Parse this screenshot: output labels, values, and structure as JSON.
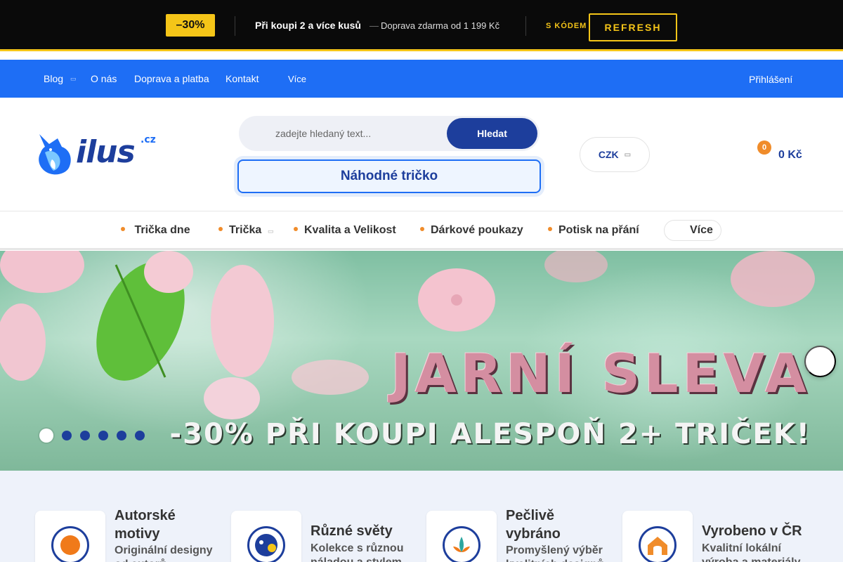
{
  "promo": {
    "badge": "–30%",
    "main": "Při koupi 2 a více kusů",
    "dash": "—",
    "shipping": " Doprava zdarma od 1 199 Kč",
    "code_label": "S KÓDEM",
    "code": "REFRESH",
    "accent": "#f5c518"
  },
  "topnav": {
    "bg": "#1e6ef5",
    "items": [
      "Blog",
      "O nás",
      "Doprava a platba",
      "Kontakt"
    ],
    "more_icon": "",
    "more": "Více",
    "account_icon": "",
    "login": " Přihlášení"
  },
  "header": {
    "logo": {
      "text": "ilus",
      "tld": ".cz"
    },
    "search": {
      "icon": "",
      "placeholder": "zadejte hledaný text...",
      "button": "Hledat"
    },
    "random_button": " Náhodné tričko",
    "currency": {
      "value": "CZK",
      "caret": "▭"
    },
    "cart": {
      "icon": "",
      "count": "0",
      "total": "0 Kč"
    }
  },
  "catnav": {
    "items": [
      " Trička dne",
      "Trička",
      "Kvalita a Velikost",
      "Dárkové poukazy",
      "Potisk na přání"
    ],
    "caret": "▭",
    "more_icon": "",
    "more": "Více"
  },
  "hero": {
    "title": "JARNÍ SLEVA",
    "subtitle": "-30% PŘI KOUPI ALESPOŇ 2+ TRIČEK!",
    "next_icon": "",
    "slides": 6,
    "active_slide": 1
  },
  "features": [
    {
      "title": "Autorské motivy",
      "desc": "Originální designy od autorů",
      "badge_color": "#f07a1a"
    },
    {
      "title": "Různé světy",
      "desc": "Kolekce s různou náladou a stylem",
      "badge_color": "#f5c518"
    },
    {
      "title": "Pečlivě vybráno",
      "desc": "Promyšlený výběr kvalitních designů",
      "badge_color": "#2ba6a0"
    },
    {
      "title": "Vyrobeno v ČR",
      "desc": "Kvalitní lokální výroba a materiály",
      "badge_color": "#f08c2a"
    }
  ],
  "colors": {
    "brand_dark": "#1d3e9c",
    "brand": "#1e6ef5",
    "orange": "#f08c2a"
  }
}
